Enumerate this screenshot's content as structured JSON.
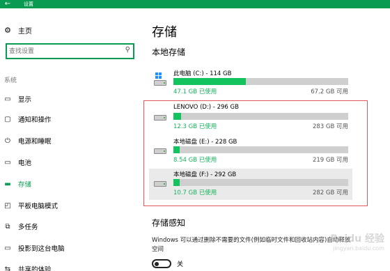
{
  "window": {
    "title": "设置",
    "back_glyph": "←"
  },
  "sidebar": {
    "home_label": "主页",
    "search_placeholder": "查找设置",
    "section_label": "系统",
    "items": [
      {
        "label": "显示",
        "icon": "monitor-icon"
      },
      {
        "label": "通知和操作",
        "icon": "message-icon"
      },
      {
        "label": "电源和睡眠",
        "icon": "power-icon"
      },
      {
        "label": "电池",
        "icon": "battery-icon"
      },
      {
        "label": "存储",
        "icon": "storage-icon",
        "active": true
      },
      {
        "label": "平板电脑模式",
        "icon": "tablet-icon"
      },
      {
        "label": "多任务",
        "icon": "multitask-icon"
      },
      {
        "label": "投影到这台电脑",
        "icon": "project-icon"
      },
      {
        "label": "共享的体验",
        "icon": "share-icon"
      }
    ]
  },
  "main": {
    "title": "存储",
    "local_storage_heading": "本地存储",
    "drives": [
      {
        "name": "此电脑 (C:) - 114 GB",
        "used": "47.1 GB 已使用",
        "free": "67.2 GB 可用",
        "fraction": 0.413,
        "system": true
      },
      {
        "name": "LENOVO (D:) - 296 GB",
        "used": "12.3 GB 已使用",
        "free": "283 GB 可用",
        "fraction": 0.042
      },
      {
        "name": "本地磁盘 (E:) - 228 GB",
        "used": "8.54 GB 已使用",
        "free": "219 GB 可用",
        "fraction": 0.037
      },
      {
        "name": "本地磁盘 (F:) - 292 GB",
        "used": "10.7 GB 已使用",
        "free": "282 GB 可用",
        "fraction": 0.037
      }
    ],
    "storage_sense_heading": "存储感知",
    "storage_sense_desc": "Windows 可以通过删除不需要的文件(例如临时文件和回收站内容)自动释放空间",
    "toggle_label": "关"
  },
  "watermark": {
    "main": "Baidu 经验",
    "sub": "jingyan.baidu.com"
  }
}
